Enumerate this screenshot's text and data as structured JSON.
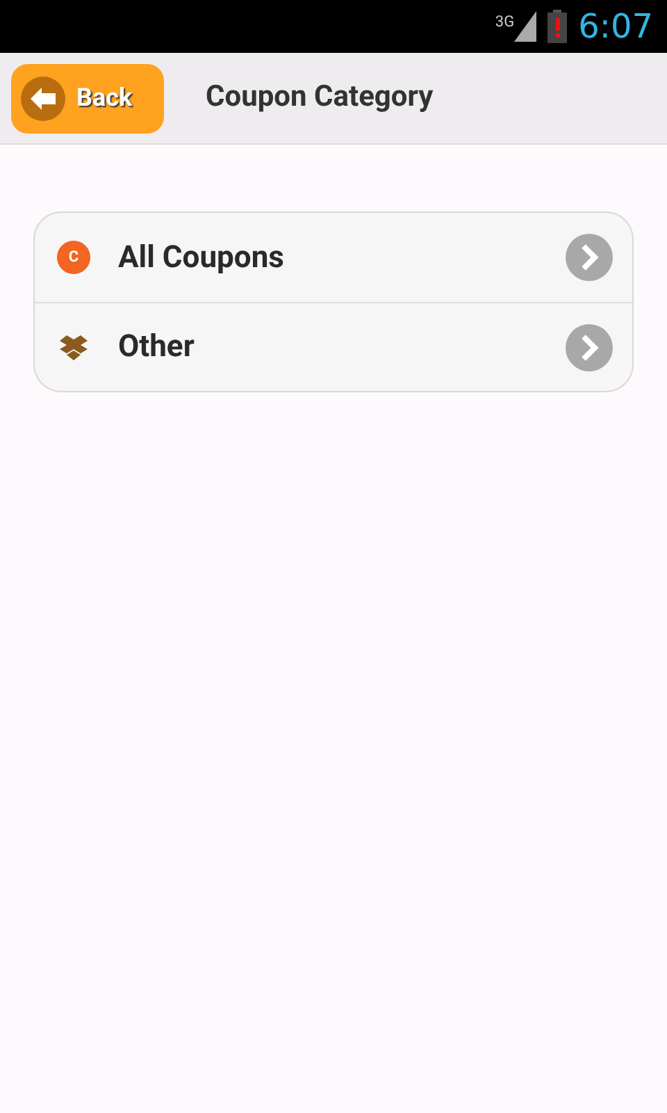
{
  "status_bar": {
    "network": "3G",
    "time": "6:07"
  },
  "header": {
    "back": "Back",
    "title": "Coupon Category"
  },
  "categories": [
    {
      "kind": "coupon",
      "icon_letter": "C",
      "label": "All Coupons"
    },
    {
      "kind": "box",
      "label": "Other"
    }
  ]
}
